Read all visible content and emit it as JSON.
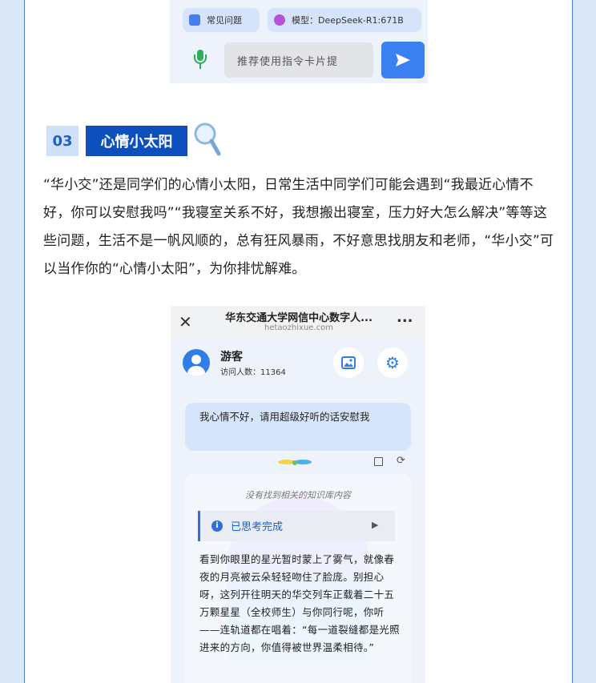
{
  "top_screenshot": {
    "chips": [
      {
        "label": "常见问题"
      },
      {
        "label": "模型：DeepSeek-R1:671B"
      }
    ],
    "input_placeholder": "推荐使用指令卡片提"
  },
  "section": {
    "number": "03",
    "title": "心情小太阳",
    "paragraph": "“华小交”还是同学们的心情小太阳，日常生活中同学们可能会遇到“我最近心情不好，你可以安慰我吗”“我寝室关系不好，我想搬出寝室，压力好大怎么解决”等等这些问题，生活不是一帆风顺的，总有狂风暴雨，不好意思找朋友和老师，“华小交”可以当作你的“心情小太阳”，为你排忧解难。"
  },
  "chat_screenshot": {
    "header_title": "华东交通大学网信中心数字人...",
    "header_url": "hetaozhixue.com",
    "more_label": "...",
    "close_label": "✕",
    "user_name": "游客",
    "visit_count": "访问人数：11364",
    "user_message": "我心情不好，请用超级好听的话安慰我",
    "no_kb_notice": "没有找到相关的知识库内容",
    "thinking_label": "已思考完成",
    "reply": "看到你眼里的星光暂时蒙上了雾气，就像春夜的月亮被云朵轻轻吻住了脸庞。别担心呀，这列开往明天的华交列车正载着二十五万颗星星（全校师生）与你同行呢，你听——连轨道都在唱着：“每一道裂缝都是光照进来的方向，你值得被世界温柔相待。”"
  },
  "colors": {
    "accent_blue": "#0d4fbd",
    "send_button": "#3a80f0",
    "page_background": "#dbe8f7"
  }
}
